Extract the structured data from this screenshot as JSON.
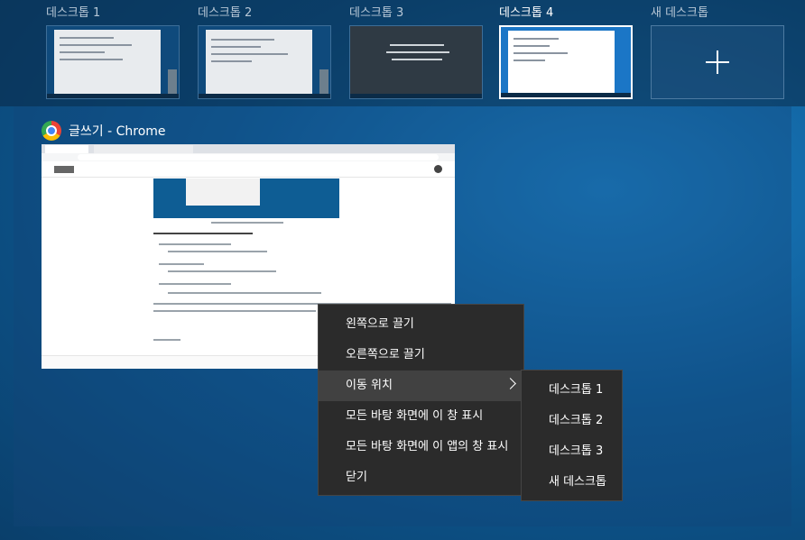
{
  "desktops": [
    {
      "label": "데스크톱 1",
      "active": false
    },
    {
      "label": "데스크톱 2",
      "active": false
    },
    {
      "label": "데스크톱 3",
      "active": false
    },
    {
      "label": "데스크톱 4",
      "active": true
    }
  ],
  "new_desktop": {
    "label": "새 데스크톱"
  },
  "window": {
    "title": "글쓰기 - Chrome",
    "icon": "chrome-icon"
  },
  "context_menu": {
    "items": [
      {
        "label": "왼쪽으로 끌기"
      },
      {
        "label": "오른쪽으로 끌기"
      },
      {
        "label": "이동 위치",
        "has_submenu": true,
        "highlighted": true
      },
      {
        "label": "모든 바탕 화면에 이 창 표시"
      },
      {
        "label": "모든 바탕 화면에 이 앱의 창 표시"
      },
      {
        "label": "닫기"
      }
    ]
  },
  "submenu": {
    "items": [
      {
        "label": "데스크톱 1"
      },
      {
        "label": "데스크톱 2"
      },
      {
        "label": "데스크톱 3"
      },
      {
        "label": "새 데스크톱"
      }
    ]
  },
  "colors": {
    "accent": "#0078d7",
    "menu_bg": "#2b2b2b",
    "menu_hover": "#414141"
  }
}
